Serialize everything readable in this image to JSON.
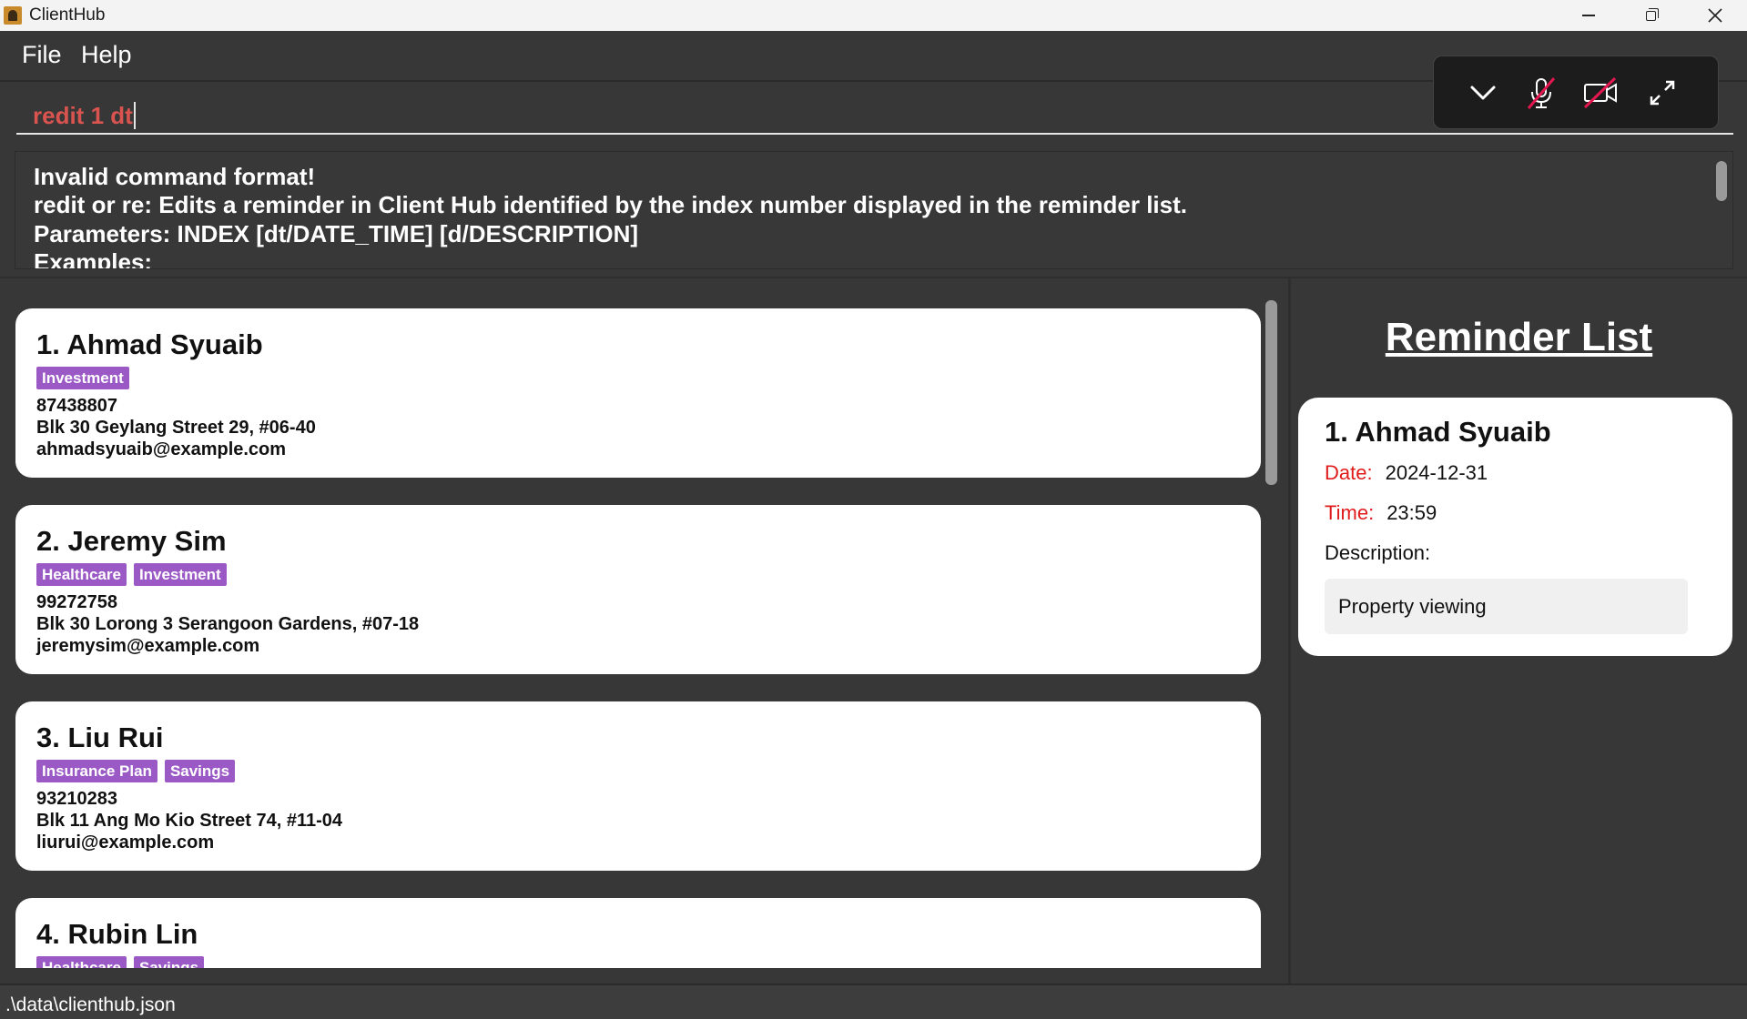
{
  "window": {
    "title": "ClientHub",
    "minimize_icon": "minimize-icon",
    "maximize_icon": "restore-icon",
    "close_icon": "close-icon"
  },
  "menu": {
    "items": [
      {
        "label": "File"
      },
      {
        "label": "Help"
      }
    ]
  },
  "command_box": {
    "value": "redit 1 dt",
    "text_color": "#d9544f"
  },
  "overlay_toolbar": {
    "icons": [
      "chevron-down-icon",
      "mic-off-icon",
      "camera-off-icon",
      "expand-icon"
    ]
  },
  "result_display": {
    "lines": [
      "Invalid command format!",
      "redit or re: Edits a reminder in Client Hub identified by the index number displayed in the reminder list.",
      "Parameters: INDEX [dt/DATE_TIME] [d/DESCRIPTION]",
      "Examples:"
    ]
  },
  "clients": [
    {
      "name": "1. Ahmad Syuaib",
      "tags": [
        "Investment"
      ],
      "phone": "87438807",
      "address": "Blk 30 Geylang Street 29, #06-40",
      "email": "ahmadsyuaib@example.com"
    },
    {
      "name": "2. Jeremy Sim",
      "tags": [
        "Healthcare",
        "Investment"
      ],
      "phone": "99272758",
      "address": "Blk 30 Lorong 3 Serangoon Gardens, #07-18",
      "email": "jeremysim@example.com"
    },
    {
      "name": "3. Liu Rui",
      "tags": [
        "Insurance Plan",
        "Savings"
      ],
      "phone": "93210283",
      "address": "Blk 11 Ang Mo Kio Street 74, #11-04",
      "email": "liurui@example.com"
    },
    {
      "name": "4. Rubin Lin",
      "tags": [
        "Healthcare",
        "Savings"
      ],
      "phone": "",
      "address": "",
      "email": ""
    }
  ],
  "reminder_panel": {
    "title": "Reminder List",
    "reminders": [
      {
        "name": "1.  Ahmad Syuaib",
        "date_label": "Date:",
        "date": "2024-12-31",
        "time_label": "Time:",
        "time": "23:59",
        "description_label": "Description:",
        "description": "Property viewing"
      }
    ]
  },
  "status_bar": {
    "path": ".\\data\\clienthub.json"
  },
  "colors": {
    "background": "#373737",
    "tag": "#9b59c6",
    "reminder_label": "#e01b1b",
    "card": "#ffffff"
  }
}
